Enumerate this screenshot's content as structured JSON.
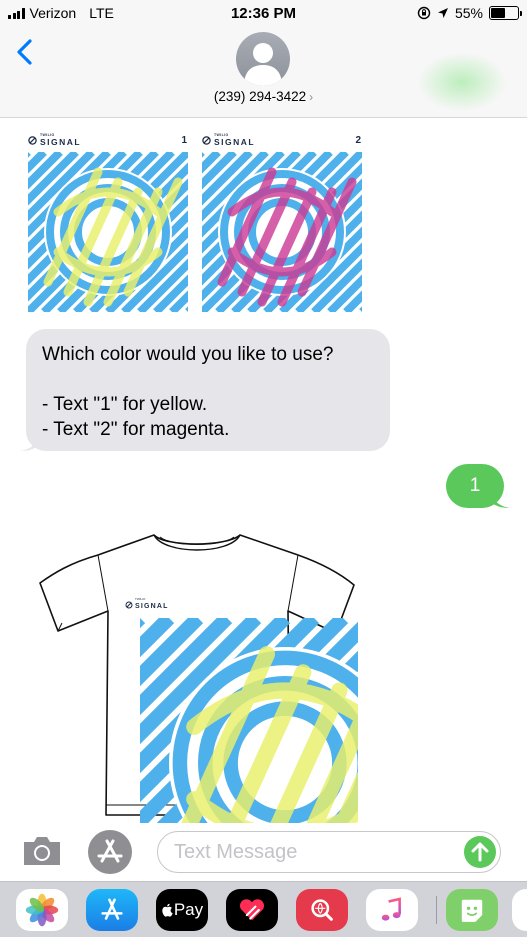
{
  "status_bar": {
    "carrier": "Verizon",
    "network": "LTE",
    "time": "12:36 PM",
    "battery_percent": "55%",
    "battery_level": 0.55,
    "icons": [
      "signal-bars-icon",
      "rotation-lock-icon",
      "location-arrow-icon",
      "battery-icon"
    ]
  },
  "header": {
    "back_icon": "chevron-left-icon",
    "avatar_icon": "person-silhouette-icon",
    "contact": "(239) 294-3422",
    "contact_chevron": "›"
  },
  "messages": {
    "mms_posters": [
      {
        "brand_small": "TWILIO",
        "brand": "SIGNAL",
        "number": "1",
        "accent": "#e9f06a"
      },
      {
        "brand_small": "TWILIO",
        "brand": "SIGNAL",
        "number": "2",
        "accent": "#cc3d96"
      }
    ],
    "incoming_text": "Which color would you like to use?\n\n- Text \"1\" for yellow.\n- Text \"2\" for magenta.",
    "outgoing_text": "1",
    "tshirt": {
      "brand_small": "TWILIO",
      "brand": "SIGNAL"
    }
  },
  "input_bar": {
    "camera_icon": "camera-icon",
    "apps_icon": "app-store-icon",
    "placeholder": "Text Message",
    "send_icon": "arrow-up-icon"
  },
  "app_drawer": {
    "apps": [
      {
        "name": "photos-icon"
      },
      {
        "name": "app-store-icon"
      },
      {
        "name": "apple-pay-icon",
        "label": "Pay"
      },
      {
        "name": "digital-touch-icon"
      },
      {
        "name": "search-images-icon"
      },
      {
        "name": "music-icon"
      },
      {
        "name": "sticker-app-icon"
      },
      {
        "name": "partial-app-icon"
      }
    ]
  },
  "colors": {
    "blue": "#4fb1ec",
    "yellow": "#e9f06a",
    "magenta": "#cc3d96",
    "outgoing_bubble": "#5ac85a",
    "incoming_bubble": "#e5e5ea",
    "ios_blue": "#007aff"
  }
}
